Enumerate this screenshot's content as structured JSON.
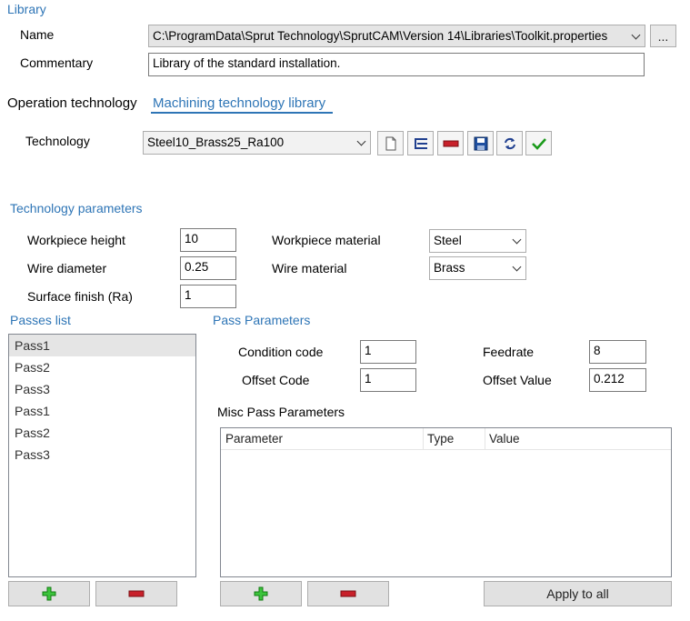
{
  "library": {
    "title": "Library",
    "name_label": "Name",
    "name_value": "C:\\ProgramData\\Sprut Technology\\SprutCAM\\Version 14\\Libraries\\Toolkit.properties",
    "browse_label": "...",
    "commentary_label": "Commentary",
    "commentary_value": "Library of the standard installation."
  },
  "tabs": {
    "operation": "Operation technology",
    "machining": "Machining technology library"
  },
  "technology": {
    "label": "Technology",
    "value": "Steel10_Brass25_Ra100",
    "toolbar_icons": [
      "new-document-icon",
      "edit-list-icon",
      "delete-icon",
      "save-icon",
      "refresh-icon",
      "apply-check-icon"
    ]
  },
  "tech_params": {
    "title": "Technology parameters",
    "workpiece_height_label": "Workpiece height",
    "workpiece_height_value": "10",
    "wire_diameter_label": "Wire diameter",
    "wire_diameter_value": "0.25",
    "surface_finish_label": "Surface finish (Ra)",
    "surface_finish_value": "1",
    "workpiece_material_label": "Workpiece material",
    "workpiece_material_value": "Steel",
    "wire_material_label": "Wire material",
    "wire_material_value": "Brass"
  },
  "passes": {
    "title": "Passes list",
    "items": [
      "Pass1",
      "Pass2",
      "Pass3",
      "Pass1",
      "Pass2",
      "Pass3"
    ],
    "selected_index": 0
  },
  "pass_params": {
    "title": "Pass Parameters",
    "condition_code_label": "Condition code",
    "condition_code_value": "1",
    "offset_code_label": "Offset Code",
    "offset_code_value": "1",
    "feedrate_label": "Feedrate",
    "feedrate_value": "8",
    "offset_value_label": "Offset Value",
    "offset_value_value": "0.212"
  },
  "misc": {
    "title": "Misc Pass Parameters",
    "columns": [
      "Parameter",
      "Type",
      "Value"
    ]
  },
  "buttons": {
    "apply_all": "Apply to all"
  },
  "colors": {
    "accent": "#2e75b6",
    "add_green": "#22a822",
    "delete_red": "#c8202a"
  }
}
